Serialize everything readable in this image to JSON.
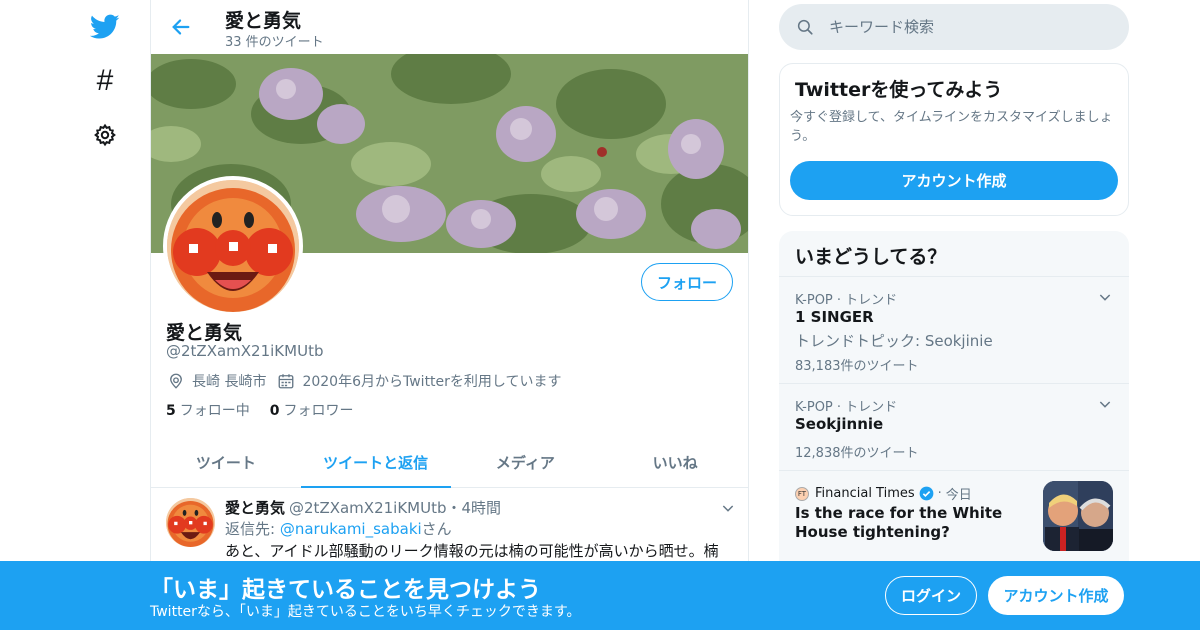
{
  "nav": {
    "explore_glyph": "#"
  },
  "topbar": {
    "title": "愛と勇気",
    "tweet_count": "33 件のツイート"
  },
  "profile": {
    "follow_label": "フォロー",
    "name": "愛と勇気",
    "handle": "@2tZXamX21iKMUtb",
    "location": "長崎 長崎市",
    "joined": "2020年6月からTwitterを利用しています",
    "following_count": "5",
    "following_label": "フォロー中",
    "followers_count": "0",
    "followers_label": "フォロワー"
  },
  "tabs": [
    {
      "label": "ツイート"
    },
    {
      "label": "ツイートと返信"
    },
    {
      "label": "メディア"
    },
    {
      "label": "いいね"
    }
  ],
  "tweet": {
    "name": "愛と勇気",
    "handle_time": "@2tZXamX21iKMUtb・4時間",
    "reply_prefix": "返信先: ",
    "reply_to": "@narukami_sabaki",
    "reply_suffix": "さん",
    "text": "あと、アイドル部騒動のリーク情報の元は楠の可能性が高いから晒せ。楠"
  },
  "search": {
    "placeholder": "キーワード検索"
  },
  "promo": {
    "title": "Twitterを使ってみよう",
    "desc": "今すぐ登録して、タイムラインをカスタマイズしましょう。",
    "button": "アカウント作成"
  },
  "trends": {
    "title": "いまどうしてる？",
    "items": [
      {
        "meta": "K-POP · トレンド",
        "name": "1 SINGER",
        "sub": "トレンドトピック: Seokjinie",
        "count": "83,183件のツイート"
      },
      {
        "meta": "K-POP · トレンド",
        "name": "Seokjinnie",
        "count": "12,838件のツイート"
      }
    ],
    "news": {
      "source": "Financial Times",
      "logo_text": "FT",
      "dot": "·",
      "time": "今日",
      "headline": "Is the race for the White House tightening?"
    }
  },
  "bottom": {
    "title": "「いま」起きていることを見つけよう",
    "subtitle": "Twitterなら、「いま」起きていることをいち早くチェックできます。",
    "login": "ログイン",
    "signup": "アカウント作成"
  },
  "colors": {
    "accent": "#1da1f2",
    "muted": "#657786",
    "text": "#14171a",
    "border": "#e6ecf0"
  }
}
